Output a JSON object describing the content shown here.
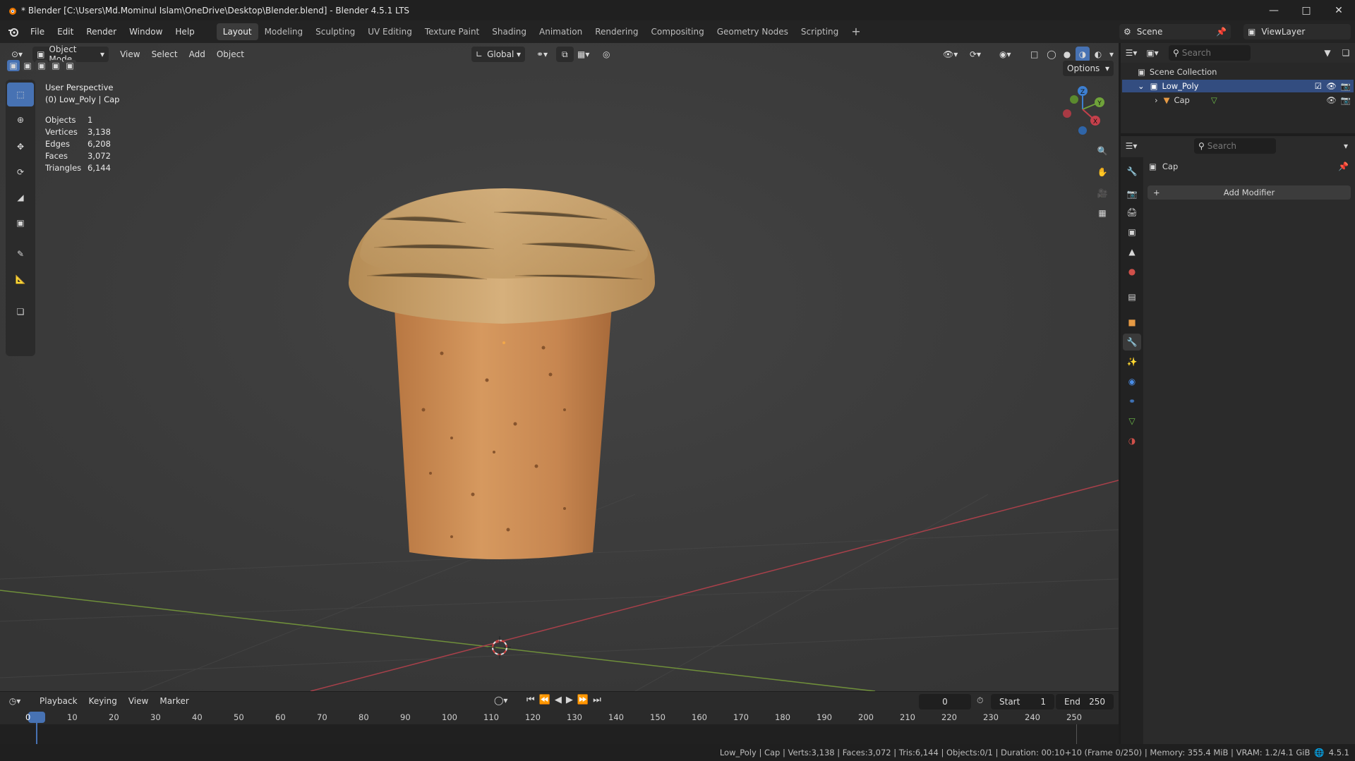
{
  "window": {
    "title": "* Blender [C:\\Users\\Md.Mominul Islam\\OneDrive\\Desktop\\Blender.blend] - Blender 4.5.1 LTS",
    "controls": [
      "minimize",
      "maximize",
      "close"
    ]
  },
  "menu": [
    "File",
    "Edit",
    "Render",
    "Window",
    "Help"
  ],
  "workspaces": [
    "Layout",
    "Modeling",
    "Sculpting",
    "UV Editing",
    "Texture Paint",
    "Shading",
    "Animation",
    "Rendering",
    "Compositing",
    "Geometry Nodes",
    "Scripting"
  ],
  "active_workspace": "Layout",
  "scene": {
    "label": "Scene",
    "view_layer": "ViewLayer"
  },
  "viewport_header": {
    "mode": "Object Mode",
    "menus": [
      "View",
      "Select",
      "Add",
      "Object"
    ],
    "orientation": "Global",
    "options": "Options"
  },
  "overlay_text": {
    "perspective": "User Perspective",
    "context": "(0) Low_Poly | Cap",
    "stats": [
      {
        "label": "Objects",
        "value": "1"
      },
      {
        "label": "Vertices",
        "value": "3,138"
      },
      {
        "label": "Edges",
        "value": "6,208"
      },
      {
        "label": "Faces",
        "value": "3,072"
      },
      {
        "label": "Triangles",
        "value": "6,144"
      }
    ]
  },
  "gizmo_axes": [
    "Z",
    "Y",
    "X"
  ],
  "outliner": {
    "search_placeholder": "Search",
    "scene_collection": "Scene Collection",
    "collection": "Low_Poly",
    "object": "Cap"
  },
  "properties": {
    "search_placeholder": "Search",
    "object_name": "Cap",
    "add_modifier": "Add Modifier"
  },
  "timeline": {
    "menus": [
      "Playback",
      "Keying",
      "View",
      "Marker"
    ],
    "current_frame": "0",
    "start_label": "Start",
    "start": "1",
    "end_label": "End",
    "end": "250",
    "ticks": [
      "0",
      "10",
      "20",
      "30",
      "40",
      "50",
      "60",
      "70",
      "80",
      "90",
      "100",
      "110",
      "120",
      "130",
      "140",
      "150",
      "160",
      "170",
      "180",
      "190",
      "200",
      "210",
      "220",
      "230",
      "240",
      "250"
    ]
  },
  "statusbar": {
    "text": "Low_Poly | Cap | Verts:3,138 | Faces:3,072 | Tris:6,144 | Objects:0/1 | Duration: 00:10+10 (Frame 0/250) | Memory: 355.4 MiB | VRAM: 1.2/4.1 GiB",
    "version": "4.5.1"
  },
  "colors": {
    "accent": "#4772b3",
    "viewport_bg": "#3d3d3d",
    "cork": "#c98a52",
    "wood": "#c9a46e",
    "x_axis": "#c4404b",
    "y_axis": "#6fa23a",
    "z_axis": "#3d7fd1"
  }
}
